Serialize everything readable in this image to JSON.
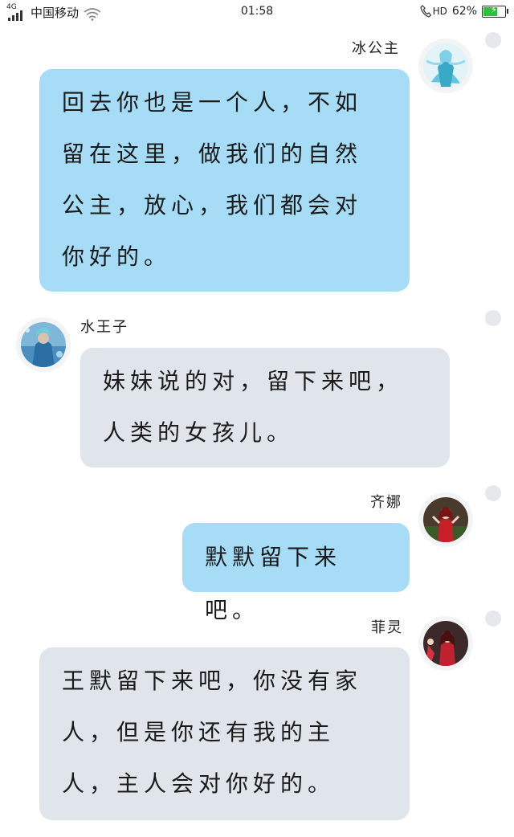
{
  "status_bar": {
    "network": "4G",
    "carrier": "中国移动",
    "time": "01:58",
    "hd": "HD",
    "battery": "62%",
    "battery_level": 0.62
  },
  "messages": [
    {
      "sender": "冰公主",
      "text": "回去你也是一个人，不如留在这里，做我们的自然公主，放心，我们都会对你好的。",
      "side": "right",
      "bubble_color": "#a6dcf6"
    },
    {
      "sender": "水王子",
      "text": "妹妹说的对，留下来吧，人类的女孩儿。",
      "side": "left",
      "bubble_color": "#dfe5ea"
    },
    {
      "sender": "齐娜",
      "text": "默默留下来吧。",
      "side": "right",
      "bubble_color": "#a6dcf6"
    },
    {
      "sender": "菲灵",
      "text": "王默留下来吧，你没有家人，但是你还有我的主人，主人会对你好的。",
      "side": "right",
      "bubble_color": "#dfe5ea"
    }
  ]
}
